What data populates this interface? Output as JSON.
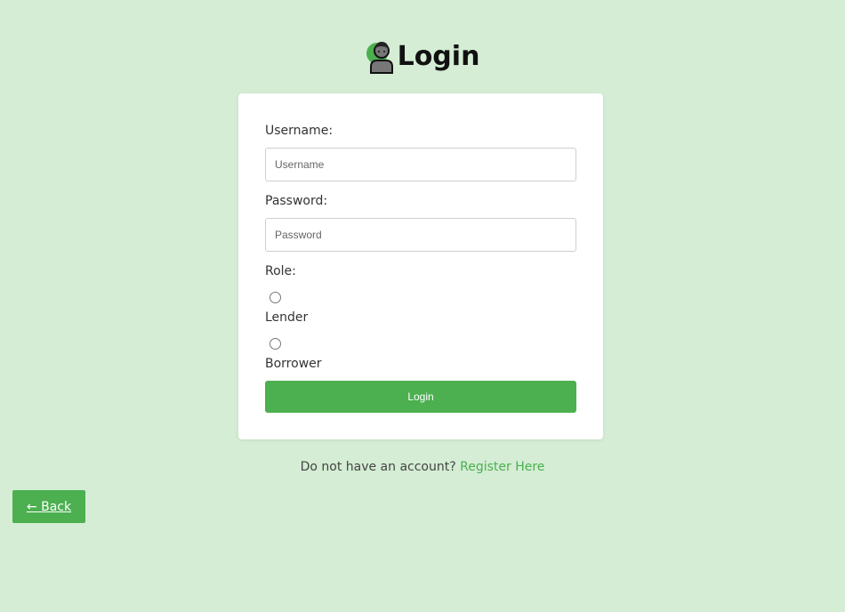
{
  "header": {
    "icon": "user-icon",
    "title": "Login"
  },
  "form": {
    "username_label": "Username:",
    "username_placeholder": "Username",
    "username_value": "",
    "password_label": "Password:",
    "password_placeholder": "Password",
    "password_value": "",
    "role_label": "Role:",
    "roles": [
      {
        "label": "Lender",
        "checked": false
      },
      {
        "label": "Borrower",
        "checked": false
      }
    ],
    "submit_label": "Login"
  },
  "footer": {
    "prompt_text": "Do not have an account?",
    "register_link": "Register Here"
  },
  "nav": {
    "back_label": "← Back"
  },
  "colors": {
    "page_background": "#d4edd4",
    "accent": "#4caf50",
    "card_background": "#ffffff"
  }
}
